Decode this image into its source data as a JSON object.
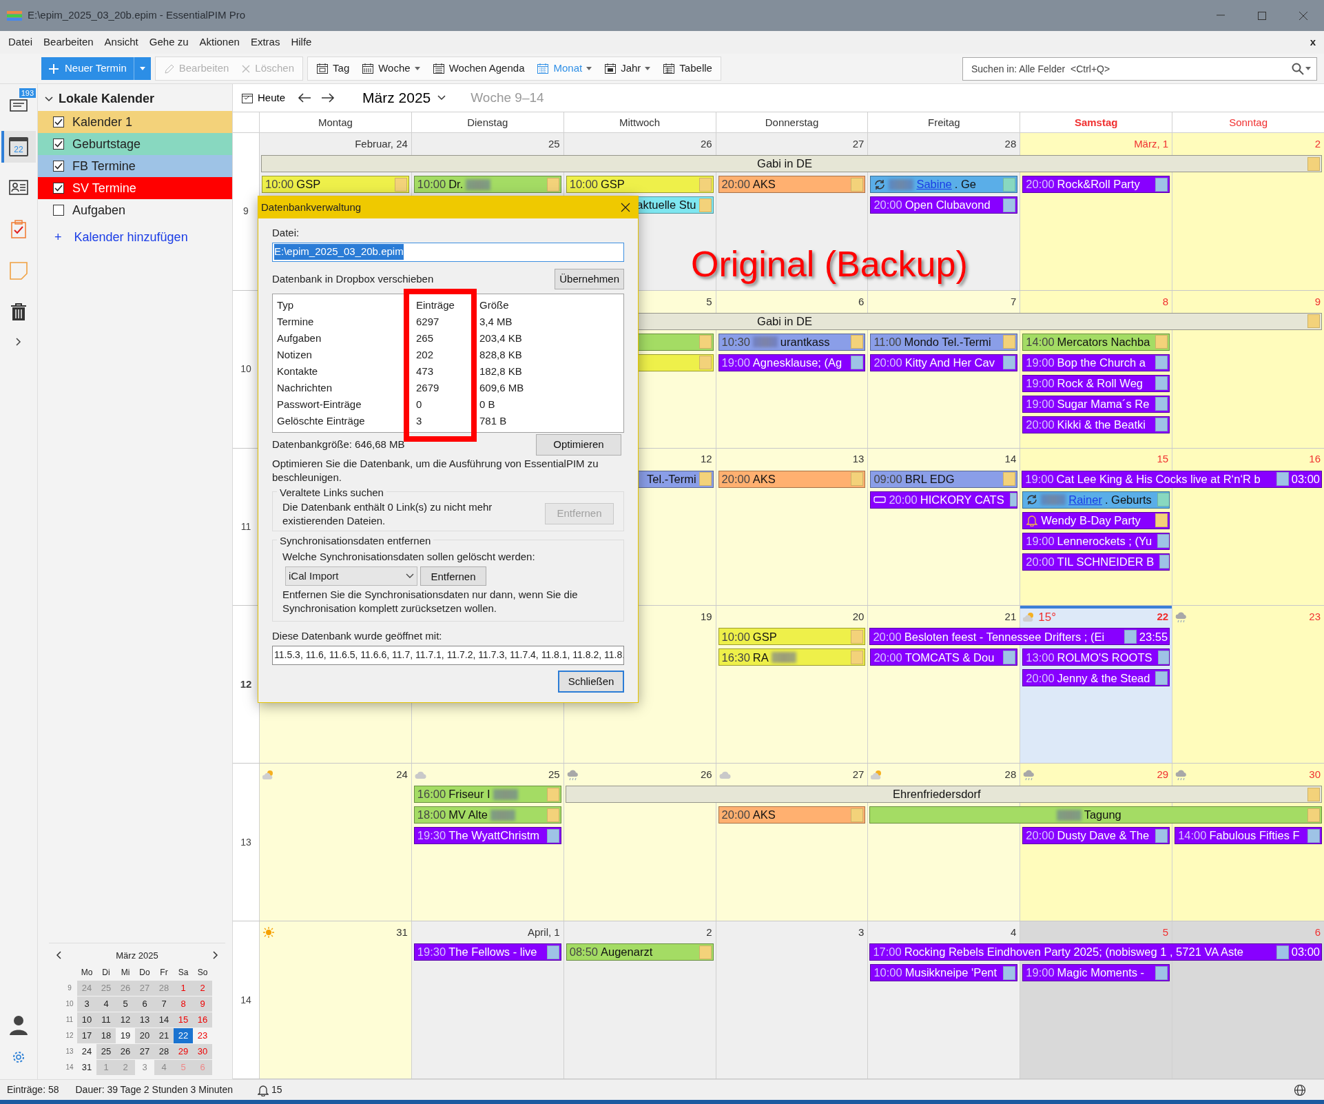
{
  "window": {
    "title": "E:\\epim_2025_03_20b.epim - EssentialPIM Pro"
  },
  "menu": [
    "Datei",
    "Bearbeiten",
    "Ansicht",
    "Gehe zu",
    "Aktionen",
    "Extras",
    "Hilfe"
  ],
  "menu_close": "x",
  "toolbar": {
    "new_button": "Neuer Termin",
    "edit": [
      {
        "label": "Bearbeiten",
        "kind": "pencil",
        "disabled": true
      },
      {
        "label": "Löschen",
        "kind": "delete",
        "disabled": true
      }
    ],
    "views": [
      {
        "label": "Tag",
        "kind": "day",
        "dropdown": false,
        "selected": false
      },
      {
        "label": "Woche",
        "kind": "week",
        "dropdown": true,
        "selected": false
      },
      {
        "label": "Wochen Agenda",
        "kind": "agenda",
        "dropdown": false,
        "selected": false
      },
      {
        "label": "Monat",
        "kind": "month",
        "dropdown": true,
        "selected": true
      },
      {
        "label": "Jahr",
        "kind": "year",
        "dropdown": true,
        "selected": false
      },
      {
        "label": "Tabelle",
        "kind": "table",
        "dropdown": false,
        "selected": false
      }
    ],
    "search": {
      "placeholder": "Suchen in: Alle Felder  <Ctrl+Q>"
    }
  },
  "modules": [
    {
      "kind": "mail",
      "badge": "193",
      "selected": false
    },
    {
      "kind": "calendar",
      "date": "22",
      "selected": true
    },
    {
      "kind": "contacts",
      "selected": false
    },
    {
      "kind": "tasks",
      "selected": false
    },
    {
      "kind": "notes",
      "selected": false
    },
    {
      "kind": "trash",
      "selected": false
    }
  ],
  "sidebar": {
    "title": "Lokale Kalender",
    "expanded": true,
    "calendars": [
      {
        "label": "Kalender 1",
        "checked": true,
        "color": "#f3d27a"
      },
      {
        "label": "Geburtstage",
        "checked": true,
        "color": "#88d8c0"
      },
      {
        "label": "FB Termine",
        "checked": true,
        "color": "#9ec3e6"
      },
      {
        "label": "SV Termine",
        "checked": true,
        "color": "#ff0000"
      },
      {
        "label": "Aufgaben",
        "checked": false
      }
    ],
    "add_plus": "+",
    "add_link": "Kalender hinzufügen",
    "mini": {
      "title": "März  2025",
      "weekdays": [
        "Mo",
        "Di",
        "Mi",
        "Do",
        "Fr",
        "Sa",
        "So"
      ],
      "weeks": [
        {
          "num": "9",
          "days": [
            {
              "text": "24",
              "other": true,
              "shaded": true,
              "selected": false
            },
            {
              "text": "25",
              "other": true,
              "shaded": true,
              "selected": false
            },
            {
              "text": "26",
              "other": true,
              "shaded": true,
              "selected": false
            },
            {
              "text": "27",
              "other": true,
              "shaded": true,
              "selected": false
            },
            {
              "text": "28",
              "other": true,
              "shaded": true,
              "selected": false
            },
            {
              "text": "1",
              "other": false,
              "shaded": true,
              "selected": false
            },
            {
              "text": "2",
              "other": false,
              "shaded": true,
              "selected": false
            }
          ]
        },
        {
          "num": "10",
          "days": [
            {
              "text": "3",
              "other": false,
              "shaded": true,
              "selected": false
            },
            {
              "text": "4",
              "other": false,
              "shaded": true,
              "selected": false
            },
            {
              "text": "5",
              "other": false,
              "shaded": true,
              "selected": false
            },
            {
              "text": "6",
              "other": false,
              "shaded": true,
              "selected": false
            },
            {
              "text": "7",
              "other": false,
              "shaded": true,
              "selected": false
            },
            {
              "text": "8",
              "other": false,
              "shaded": true,
              "selected": false
            },
            {
              "text": "9",
              "other": false,
              "shaded": true,
              "selected": false
            }
          ]
        },
        {
          "num": "11",
          "days": [
            {
              "text": "10",
              "other": false,
              "shaded": true,
              "selected": false
            },
            {
              "text": "11",
              "other": false,
              "shaded": true,
              "selected": false
            },
            {
              "text": "12",
              "other": false,
              "shaded": true,
              "selected": false
            },
            {
              "text": "13",
              "other": false,
              "shaded": true,
              "selected": false
            },
            {
              "text": "14",
              "other": false,
              "shaded": true,
              "selected": false
            },
            {
              "text": "15",
              "other": false,
              "shaded": true,
              "selected": false
            },
            {
              "text": "16",
              "other": false,
              "shaded": true,
              "selected": false
            }
          ]
        },
        {
          "num": "12",
          "days": [
            {
              "text": "17",
              "other": false,
              "shaded": true,
              "selected": false
            },
            {
              "text": "18",
              "other": false,
              "shaded": true,
              "selected": false
            },
            {
              "text": "19",
              "other": false,
              "shaded": false,
              "selected": false
            },
            {
              "text": "20",
              "other": false,
              "shaded": true,
              "selected": false
            },
            {
              "text": "21",
              "other": false,
              "shaded": true,
              "selected": false
            },
            {
              "text": "22",
              "other": false,
              "shaded": true,
              "selected": true
            },
            {
              "text": "23",
              "other": false,
              "shaded": false,
              "selected": false
            }
          ]
        },
        {
          "num": "13",
          "days": [
            {
              "text": "24",
              "other": false,
              "shaded": false,
              "selected": false
            },
            {
              "text": "25",
              "other": false,
              "shaded": true,
              "selected": false
            },
            {
              "text": "26",
              "other": false,
              "shaded": true,
              "selected": false
            },
            {
              "text": "27",
              "other": false,
              "shaded": true,
              "selected": false
            },
            {
              "text": "28",
              "other": false,
              "shaded": true,
              "selected": false
            },
            {
              "text": "29",
              "other": false,
              "shaded": true,
              "selected": false
            },
            {
              "text": "30",
              "other": false,
              "shaded": true,
              "selected": false
            }
          ]
        },
        {
          "num": "14",
          "days": [
            {
              "text": "31",
              "other": false,
              "shaded": false,
              "selected": false
            },
            {
              "text": "1",
              "other": true,
              "shaded": true,
              "selected": false
            },
            {
              "text": "2",
              "other": true,
              "shaded": true,
              "selected": false
            },
            {
              "text": "3",
              "other": true,
              "shaded": false,
              "selected": false
            },
            {
              "text": "4",
              "other": true,
              "shaded": true,
              "selected": false
            },
            {
              "text": "5",
              "other": true,
              "shaded": true,
              "selected": false
            },
            {
              "text": "6",
              "other": true,
              "shaded": true,
              "selected": false
            }
          ]
        }
      ]
    }
  },
  "calendar": {
    "today_button": "Heute",
    "period": "März 2025",
    "weeks_label": "Woche 9–14",
    "day_headers": [
      {
        "label": "Montag",
        "weekend": false,
        "today": false
      },
      {
        "label": "Dienstag",
        "weekend": false,
        "today": false
      },
      {
        "label": "Mittwoch",
        "weekend": false,
        "today": false
      },
      {
        "label": "Donnerstag",
        "weekend": false,
        "today": false
      },
      {
        "label": "Freitag",
        "weekend": false,
        "today": false
      },
      {
        "label": "Samstag",
        "weekend": true,
        "today": true
      },
      {
        "label": "Sonntag",
        "weekend": true,
        "today": false
      }
    ],
    "weeks": [
      {
        "num": "9",
        "current": false,
        "days": [
          {
            "date": "Februar, 24",
            "other": true,
            "today": false,
            "events": [
              {
                "kind": "allday",
                "title": "Gabi in DE",
                "color": "#e6e6d6",
                "category": {
                  "color": "#f3d27a"
                }
              },
              {
                "kind": "timed",
                "time": "10:00",
                "title": "GSP",
                "color": "#eef04a",
                "category": {
                  "color": "#f3d27a"
                }
              }
            ]
          },
          {
            "date": "25",
            "other": true,
            "today": false,
            "events": [
              {
                "kind": "continued"
              },
              {
                "kind": "timed",
                "time": "10:00",
                "title": "Dr.",
                "redacted_after": true,
                "color": "#a4dc64",
                "category": {
                  "color": "#f3d27a"
                }
              }
            ]
          },
          {
            "date": "26",
            "other": true,
            "today": false,
            "events": [
              {
                "kind": "continued"
              },
              {
                "kind": "timed",
                "time": "10:00",
                "title": "GSP",
                "color": "#eef04a",
                "category": {
                  "color": "#f3d27a"
                }
              },
              {
                "kind": "timed",
                "title": "aktuelle Stu",
                "covered": true,
                "color": "#7ee6f0",
                "category": {
                  "color": "#f3d27a"
                }
              }
            ]
          },
          {
            "date": "27",
            "other": true,
            "today": false,
            "events": [
              {
                "kind": "continued"
              },
              {
                "kind": "timed",
                "time": "20:00",
                "title": "AKS",
                "color": "#ffb070",
                "category": {
                  "color": "#f3d27a"
                }
              }
            ]
          },
          {
            "date": "28",
            "other": true,
            "today": false,
            "events": [
              {
                "kind": "continued"
              },
              {
                "kind": "birthday",
                "redacted_before": true,
                "link": "Sabine",
                "title": ". Ge",
                "color": "#5aaee8",
                "category": {
                  "color": "#88d8c0"
                }
              },
              {
                "kind": "timed",
                "time": "20:00",
                "title": "Open Clubavond",
                "color": "#8800ff",
                "category": {
                  "color": "#9ec3e6"
                }
              }
            ]
          },
          {
            "date": "März, 1",
            "other": false,
            "today": false,
            "events": [
              {
                "kind": "continued"
              },
              {
                "kind": "timed",
                "time": "20:00",
                "title": "Rock&Roll Party",
                "color": "#8800ff",
                "category": {
                  "color": "#9ec3e6"
                }
              }
            ]
          },
          {
            "date": "2",
            "other": false,
            "today": false,
            "events": [
              {
                "kind": "continued"
              }
            ]
          }
        ]
      },
      {
        "num": "10",
        "current": false,
        "days": [
          {
            "events": [
              {
                "kind": "allday",
                "title": "Gabi in DE",
                "color": "#e6e6d6",
                "category": {
                  "color": "#f3d27a"
                }
              }
            ]
          },
          {
            "events": [
              {
                "kind": "continued"
              }
            ]
          },
          {
            "date": "5",
            "other": false,
            "today": false,
            "events": [
              {
                "kind": "continued"
              },
              {
                "kind": "bar",
                "color": "#a4dc64",
                "category": {
                  "color": "#f3d27a"
                }
              },
              {
                "kind": "bar",
                "color": "#eef04a",
                "category": {
                  "color": "#f3d27a"
                }
              }
            ]
          },
          {
            "date": "6",
            "other": false,
            "today": false,
            "events": [
              {
                "kind": "continued"
              },
              {
                "kind": "timed",
                "time": "10:30",
                "redacted_before": true,
                "title": "urantkass",
                "color": "#8a9ee8",
                "category": {
                  "color": "#f3d27a"
                }
              },
              {
                "kind": "timed",
                "time": "19:00",
                "title": "Agnesklause; (Ag",
                "color": "#8800ff",
                "category": {
                  "color": "#9ec3e6"
                }
              }
            ]
          },
          {
            "date": "7",
            "other": false,
            "today": false,
            "events": [
              {
                "kind": "continued"
              },
              {
                "kind": "timed",
                "time": "11:00",
                "title": "Mondo Tel.-Termi",
                "color": "#8a9ee8",
                "category": {
                  "color": "#f3d27a"
                }
              },
              {
                "kind": "timed",
                "time": "20:00",
                "title": "Kitty And Her Cav",
                "color": "#8800ff",
                "category": {
                  "color": "#9ec3e6"
                }
              }
            ]
          },
          {
            "date": "8",
            "other": false,
            "today": false,
            "events": [
              {
                "kind": "continued"
              },
              {
                "kind": "timed",
                "time": "14:00",
                "title": "Mercators Nachba",
                "color": "#a4dc64",
                "category": {
                  "color": "#f3d27a"
                }
              },
              {
                "kind": "timed",
                "time": "19:00",
                "title": "Bop the Church a",
                "color": "#8800ff",
                "category": {
                  "color": "#9ec3e6"
                }
              },
              {
                "kind": "timed",
                "time": "19:00",
                "title": "Rock & Roll Weg",
                "color": "#8800ff",
                "category": {
                  "color": "#9ec3e6"
                }
              },
              {
                "kind": "timed",
                "time": "19:00",
                "title": "Sugar Mama´s Re",
                "color": "#8800ff",
                "category": {
                  "color": "#9ec3e6"
                }
              },
              {
                "kind": "timed",
                "time": "20:00",
                "title": "Kikki & the Beatki",
                "color": "#8800ff",
                "category": {
                  "color": "#9ec3e6"
                }
              }
            ]
          },
          {
            "date": "9",
            "other": false,
            "today": false,
            "events": [
              {
                "kind": "continued"
              }
            ]
          }
        ]
      },
      {
        "num": "11",
        "current": false,
        "days": [
          {
            "date": "12",
            "other": false,
            "today": false,
            "events": [
              {
                "kind": "timed",
                "title": "Tel.-Termi",
                "covered": true,
                "color": "#8a9ee8",
                "category": {
                  "color": "#f3d27a"
                }
              }
            ]
          },
          {
            "date": "13",
            "other": false,
            "today": false,
            "events": [
              {
                "kind": "timed",
                "time": "20:00",
                "title": "AKS",
                "color": "#ffb070",
                "category": {
                  "color": "#f3d27a"
                }
              }
            ]
          },
          {
            "date": "14",
            "other": false,
            "today": false,
            "events": [
              {
                "kind": "timed",
                "time": "09:00",
                "title": "BRL EDG",
                "color": "#8a9ee8",
                "category": {
                  "color": "#f3d27a"
                }
              },
              {
                "kind": "tagged",
                "time": "20:00",
                "title": "HICKORY CATS",
                "color": "#8800ff",
                "category": {
                  "color": "#9ec3e6"
                }
              }
            ]
          },
          {
            "date": "15",
            "other": false,
            "today": false,
            "events": [
              {
                "kind": "timed",
                "time": "19:00",
                "title": "Cat Lee King & His Cocks live at R‘n‘R b",
                "end": "03:00",
                "color": "#8800ff",
                "category": {
                  "color": "#9ec3e6"
                }
              },
              {
                "kind": "birthday",
                "redacted_before": true,
                "link": "Rainer",
                "title": ". Geburts",
                "color": "#5aaee8",
                "category": {
                  "color": "#88d8c0"
                }
              },
              {
                "kind": "reminder",
                "title": "Wendy B-Day Party",
                "color": "#8800ff",
                "category": {
                  "color": "#f3d27a"
                }
              },
              {
                "kind": "timed",
                "time": "19:00",
                "title": "Lennerockets ; (Yu",
                "color": "#8800ff",
                "category": {
                  "color": "#9ec3e6"
                }
              },
              {
                "kind": "timed",
                "time": "20:00",
                "title": "TIL SCHNEIDER B",
                "color": "#8800ff",
                "category": {
                  "color": "#9ec3e6"
                }
              }
            ]
          },
          {
            "date": "16",
            "other": false,
            "today": false,
            "events": [
              {
                "kind": "continued"
              }
            ]
          }
        ]
      },
      {
        "num": "12",
        "current": true,
        "days": [
          {
            "other": false,
            "today": false
          },
          {
            "other": false,
            "today": false
          },
          {
            "date": "19",
            "other": false,
            "today": false
          },
          {
            "date": "20",
            "other": false,
            "today": false,
            "events": [
              {
                "kind": "timed",
                "time": "10:00",
                "title": "GSP",
                "color": "#eef04a",
                "category": {
                  "color": "#f3d27a"
                }
              },
              {
                "kind": "timed",
                "time": "16:30",
                "title": "RA",
                "redacted_after": true,
                "color": "#eef04a",
                "category": {
                  "color": "#f3d27a"
                }
              }
            ]
          },
          {
            "date": "21",
            "other": false,
            "today": false,
            "events": [
              {
                "kind": "timed",
                "time": "20:00",
                "title": "Besloten feest - Tennessee Drifters ; (Ei",
                "end": "23:55",
                "color": "#8800ff",
                "category": {
                  "color": "#9ec3e6"
                }
              },
              {
                "kind": "timed",
                "time": "20:00",
                "title": "TOMCATS & Dou",
                "color": "#8800ff",
                "category": {
                  "color": "#9ec3e6"
                }
              }
            ]
          },
          {
            "date": "22",
            "other": false,
            "today": true,
            "weather": {
              "kind": "partly",
              "temp": "15°"
            },
            "events": [
              {
                "kind": "continued"
              },
              {
                "kind": "timed",
                "time": "13:00",
                "title": "ROLMO'S ROOTS",
                "color": "#8800ff",
                "category": {
                  "color": "#9ec3e6"
                }
              },
              {
                "kind": "timed",
                "time": "20:00",
                "title": "Jenny & the Stead",
                "color": "#8800ff",
                "category": {
                  "color": "#9ec3e6"
                }
              }
            ]
          },
          {
            "date": "23",
            "other": false,
            "today": false,
            "weather": {
              "kind": "rain"
            }
          }
        ]
      },
      {
        "num": "13",
        "current": false,
        "days": [
          {
            "date": "24",
            "other": false,
            "today": false,
            "weather": {
              "kind": "partly"
            }
          },
          {
            "date": "25",
            "other": false,
            "today": false,
            "weather": {
              "kind": "cloud"
            },
            "events": [
              {
                "kind": "timed",
                "time": "16:00",
                "title": "Friseur I",
                "redacted_after": true,
                "color": "#a4dc64",
                "category": {
                  "color": "#f3d27a"
                }
              },
              {
                "kind": "timed",
                "time": "18:00",
                "title": "MV Alte",
                "redacted_after": true,
                "color": "#a4dc64",
                "category": {
                  "color": "#f3d27a"
                }
              },
              {
                "kind": "timed",
                "time": "19:30",
                "title": "The WyattChristm",
                "color": "#8800ff",
                "category": {
                  "color": "#9ec3e6"
                }
              }
            ]
          },
          {
            "date": "26",
            "other": false,
            "today": false,
            "weather": {
              "kind": "rain"
            },
            "events": [
              {
                "kind": "allday",
                "title": "Ehrenfriedersdorf",
                "color": "#e6e6d6",
                "category": {
                  "color": "#f3d27a"
                }
              }
            ]
          },
          {
            "date": "27",
            "other": false,
            "today": false,
            "weather": {
              "kind": "cloud"
            },
            "events": [
              {
                "kind": "continued"
              },
              {
                "kind": "timed",
                "time": "20:00",
                "title": "AKS",
                "color": "#ffb070",
                "category": {
                  "color": "#f3d27a"
                }
              }
            ]
          },
          {
            "date": "28",
            "other": false,
            "today": false,
            "weather": {
              "kind": "partly"
            },
            "events": [
              {
                "kind": "continued"
              },
              {
                "kind": "allday",
                "title": "Tagung",
                "redacted_before": true,
                "color": "#a4dc64",
                "category": {
                  "color": "#f3d27a"
                }
              }
            ]
          },
          {
            "date": "29",
            "other": false,
            "today": false,
            "weather": {
              "kind": "rain"
            },
            "events": [
              {
                "kind": "continued"
              },
              {
                "kind": "continued"
              },
              {
                "kind": "timed",
                "time": "20:00",
                "title": "Dusty Dave & The",
                "color": "#8800ff",
                "category": {
                  "color": "#9ec3e6"
                }
              }
            ]
          },
          {
            "date": "30",
            "other": false,
            "today": false,
            "weather": {
              "kind": "rain"
            },
            "events": [
              {
                "kind": "continued"
              },
              {
                "kind": "continued"
              },
              {
                "kind": "timed",
                "time": "14:00",
                "title": "Fabulous Fifties F",
                "color": "#8800ff",
                "category": {
                  "color": "#9ec3e6"
                }
              }
            ]
          }
        ]
      },
      {
        "num": "14",
        "current": false,
        "days": [
          {
            "date": "31",
            "other": false,
            "today": false,
            "weather": {
              "kind": "sun"
            }
          },
          {
            "date": "April, 1",
            "other": true,
            "today": false,
            "events": [
              {
                "kind": "timed",
                "time": "19:30",
                "title": "The Fellows - live",
                "color": "#8800ff",
                "category": {
                  "color": "#9ec3e6"
                }
              }
            ]
          },
          {
            "date": "2",
            "other": true,
            "today": false,
            "events": [
              {
                "kind": "timed",
                "time": "08:50",
                "title": "Augenarzt",
                "color": "#a4dc64",
                "category": {
                  "color": "#f3d27a"
                }
              }
            ]
          },
          {
            "date": "3",
            "other": true,
            "today": false
          },
          {
            "date": "4",
            "other": true,
            "today": false,
            "events": [
              {
                "kind": "timed",
                "time": "17:00",
                "title": "Rocking Rebels Eindhoven Party 2025; (nobisweg 1 , 5721 VA Aste",
                "end": "03:00",
                "color": "#8800ff",
                "category": {
                  "color": "#9ec3e6"
                }
              },
              {
                "kind": "timed",
                "time": "10:00",
                "title": "Musikkneipe 'Pent",
                "color": "#8800ff",
                "category": {
                  "color": "#9ec3e6"
                }
              }
            ]
          },
          {
            "date": "5",
            "other": true,
            "today": false,
            "events": [
              {
                "kind": "continued"
              },
              {
                "kind": "timed",
                "time": "19:00",
                "title": "Magic Moments -",
                "color": "#8800ff",
                "category": {
                  "color": "#9ec3e6"
                }
              }
            ]
          },
          {
            "date": "6",
            "other": true,
            "today": false,
            "events": [
              {
                "kind": "continued"
              }
            ]
          }
        ]
      }
    ]
  },
  "annotation": {
    "text": "Original (Backup)"
  },
  "dialog": {
    "title": "Datenbankverwaltung",
    "file_label": "Datei:",
    "file_value": "E:\\epim_2025_03_20b.epim",
    "file_selected": true,
    "dropbox_label": "Datenbank in Dropbox verschieben",
    "apply_button": "Übernehmen",
    "table": {
      "columns": [
        "Typ",
        "Einträge",
        "Größe"
      ],
      "rows": [
        [
          "Termine",
          "6297",
          "3,4 MB"
        ],
        [
          "Aufgaben",
          "265",
          "203,4 KB"
        ],
        [
          "Notizen",
          "202",
          "828,8 KB"
        ],
        [
          "Kontakte",
          "473",
          "182,8 KB"
        ],
        [
          "Nachrichten",
          "2679",
          "609,6 MB"
        ],
        [
          "Passwort-Einträge",
          "0",
          "0 B"
        ],
        [
          "Gelöschte Einträge",
          "3",
          "781 B"
        ]
      ]
    },
    "size_label": "Datenbankgröße: 646,68 MB",
    "optimize_button": "Optimieren",
    "optimize_hint": "Optimieren Sie die Datenbank, um die Ausführung von EssentialPIM zu beschleunigen.",
    "links_group": {
      "legend": "Veraltete Links suchen",
      "text": "Die Datenbank enthält 0 Link(s) zu nicht mehr existierenden Dateien.",
      "button": "Entfernen",
      "button_disabled": true
    },
    "sync_group": {
      "legend": "Synchronisationsdaten entfernen",
      "question": "Welche Synchronisationsdaten sollen gelöscht werden:",
      "select_value": "iCal Import",
      "button": "Entfernen",
      "hint": "Entfernen Sie die Synchronisationsdaten nur dann, wenn Sie die Synchronisation komplett zurücksetzen wollen."
    },
    "versions_label": "Diese Datenbank wurde geöffnet mit:",
    "versions_value": "11.5.3, 11.6, 11.6.5, 11.6.6, 11.7, 11.7.1, 11.7.2, 11.7.3, 11.7.4, 11.8.1, 11.8.2, 11.8.",
    "close_button": "Schließen"
  },
  "status_bar": {
    "entries": "Einträge: 58",
    "duration": "Dauer: 39 Tage 2 Stunden 3 Minuten",
    "reminders": "15"
  }
}
